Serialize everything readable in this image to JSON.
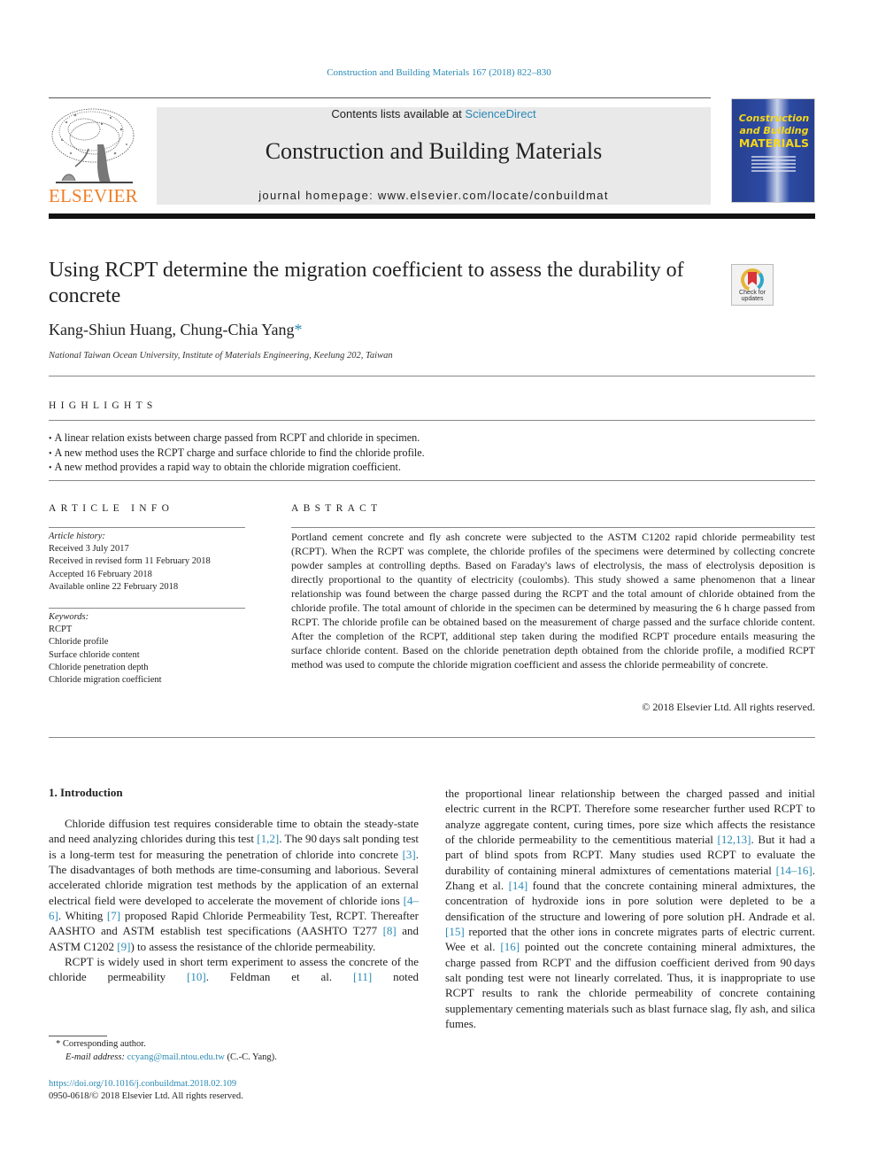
{
  "journal_reference": "Construction and Building Materials 167 (2018) 822–830",
  "header": {
    "contents_prefix": "Contents lists available at ",
    "contents_link": "ScienceDirect",
    "journal_title": "Construction and Building Materials",
    "homepage": "journal homepage: www.elsevier.com/locate/conbuildmat",
    "publisher_logo_text": "ELSEVIER",
    "cover": {
      "line1": "Construction",
      "line2": "and Building",
      "line3": "MATERIALS",
      "title_color": "#f6d61a",
      "background_color": "#2c4aa3"
    },
    "brand_color": "#f07e26",
    "link_color": "#2a8ab5"
  },
  "article": {
    "title": "Using RCPT determine the migration coefficient to assess the durability of concrete",
    "check_updates_label_1": "Check for",
    "check_updates_label_2": "updates",
    "authors": "Kang-Shiun Huang, Chung-Chia Yang",
    "corresponding_marker": "*",
    "affiliation": "National Taiwan Ocean University, Institute of Materials Engineering, Keelung 202, Taiwan"
  },
  "highlights": {
    "heading": "HIGHLIGHTS",
    "items": [
      "A linear relation exists between charge passed from RCPT and chloride in specimen.",
      "A new method uses the RCPT charge and surface chloride to find the chloride profile.",
      "A new method provides a rapid way to obtain the chloride migration coefficient."
    ]
  },
  "article_info": {
    "heading": "ARTICLE INFO",
    "history_label": "Article history:",
    "history": [
      "Received 3 July 2017",
      "Received in revised form 11 February 2018",
      "Accepted 16 February 2018",
      "Available online 22 February 2018"
    ],
    "keywords_label": "Keywords:",
    "keywords": [
      "RCPT",
      "Chloride profile",
      "Surface chloride content",
      "Chloride penetration depth",
      "Chloride migration coefficient"
    ]
  },
  "abstract": {
    "heading": "ABSTRACT",
    "text": "Portland cement concrete and fly ash concrete were subjected to the ASTM C1202 rapid chloride perme­ability test (RCPT). When the RCPT was complete, the chloride profiles of the specimens were determined by collecting concrete powder samples at controlling depths. Based on Faraday's laws of electrolysis, the mass of electrolysis deposition is directly proportional to the quantity of electricity (coulombs). This study showed a same phenomenon that a linear relationship was found between the charge passed dur­ing the RCPT and the total amount of chloride obtained from the chloride profile. The total amount of chloride in the specimen can be determined by measuring the 6 h charge passed from RCPT. The chloride profile can be obtained based on the measurement of charge passed and the surface chloride content. After the completion of the RCPT, additional step taken during the modified RCPT procedure entails mea­suring the surface chloride content. Based on the chloride penetration depth obtained from the chloride profile, a modified RCPT method was used to compute the chloride migration coefficient and assess the chloride permeability of concrete.",
    "copyright": "© 2018 Elsevier Ltd. All rights reserved."
  },
  "introduction": {
    "heading": "1. Introduction",
    "paragraphs": [
      [
        {
          "t": "Chloride diffusion test requires considerable time to obtain the steady-state and need analyzing chlorides during this test "
        },
        {
          "ref": "[1,2]"
        },
        {
          "t": ". The 90 days salt ponding test is a long-term test for measuring the penetration of chloride into concrete "
        },
        {
          "ref": "[3]"
        },
        {
          "t": ". The disadvantages of both methods are time-consuming and laborious. Several accel­erated chloride migration test methods by the application of an external electrical field were developed to accelerate the move­ment of chloride ions "
        },
        {
          "ref": "[4–6]"
        },
        {
          "t": ". Whiting "
        },
        {
          "ref": "[7]"
        },
        {
          "t": " proposed Rapid Chloride Permeability Test, RCPT. Thereafter AASHTO and ASTM establish test specifications (AASHTO T277 "
        },
        {
          "ref": "[8]"
        },
        {
          "t": " and ASTM C1202 "
        },
        {
          "ref": "[9]"
        },
        {
          "t": ") to assess the resistance of the chloride permeability."
        }
      ],
      [
        {
          "t": "RCPT is widely used in short term experiment to assess the con­crete of the chloride permeability "
        },
        {
          "ref": "[10]"
        },
        {
          "t": ". Feldman et al. "
        },
        {
          "ref": "[11]"
        },
        {
          "t": " noted the proportional linear relationship between the charged passed and initial electric current in the RCPT. Therefore some researcher further used RCPT to analyze aggregate content, curing times, pore size which affects the resistance of the chloride permeability to the cementitious material "
        },
        {
          "ref": "[12,13]"
        },
        {
          "t": ". But it had a part of blind spots from RCPT. Many studies used RCPT to evaluate the durability of con­taining mineral admixtures of cementations material "
        },
        {
          "ref": "[14–16]"
        },
        {
          "t": ". Zhang et al. "
        },
        {
          "ref": "[14]"
        },
        {
          "t": " found that the concrete containing mineral admixtures, the concentration of hydroxide ions in pore solution were depleted to be a densification of the structure and lowering of pore solution pH. Andrade et al. "
        },
        {
          "ref": "[15]"
        },
        {
          "t": " reported that the other ions in concrete migrates parts of electric current. Wee et al. "
        },
        {
          "ref": "[16]"
        },
        {
          "t": " pointed out the concrete containing mineral admixtures, the charge passed from RCPT and the diffusion coefficient derived from 90 days salt ponding test were not linearly correlated. Thus, it is inappropriate to use RCPT results to rank the chloride permeability of concrete containing supplementary cementing materials such as blast furnace slag, fly ash, and silica fumes."
        }
      ]
    ]
  },
  "footnotes": {
    "marker": "*",
    "corresponding": "Corresponding author.",
    "email_label": "E-mail address:",
    "email": "ccyang@mail.ntou.edu.tw",
    "email_suffix": "(C.-C. Yang).",
    "doi": "https://doi.org/10.1016/j.conbuildmat.2018.02.109",
    "issn_copyright": "0950-0618/© 2018 Elsevier Ltd. All rights reserved."
  }
}
